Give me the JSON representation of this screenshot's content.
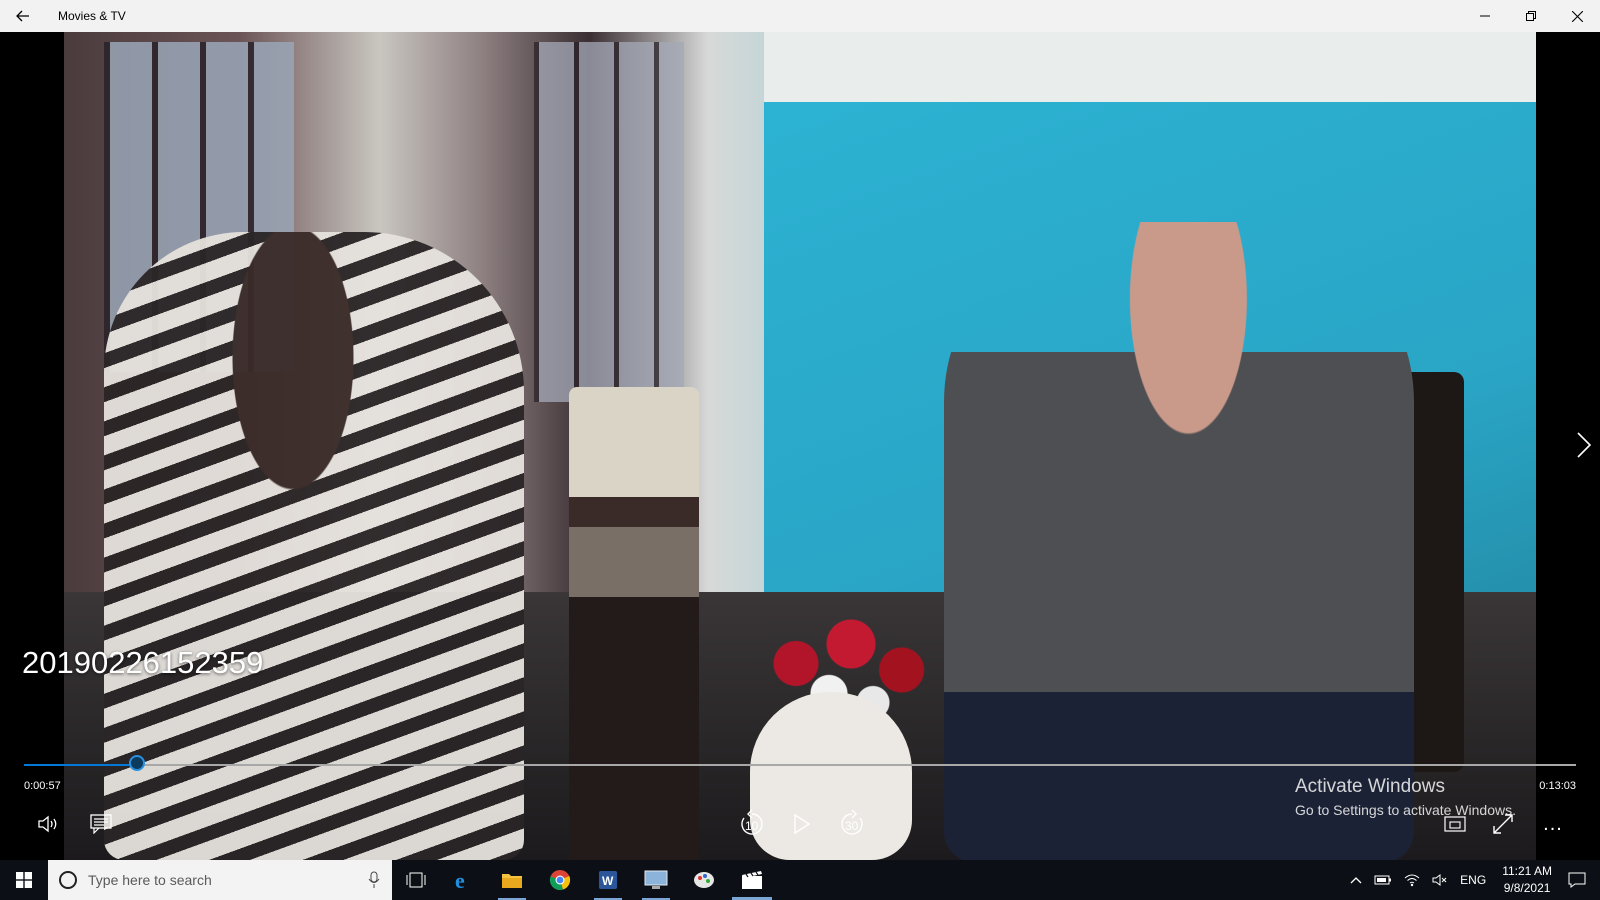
{
  "window": {
    "title": "Movies & TV",
    "back_icon": "back-arrow-icon",
    "minimize_icon": "minimize-icon",
    "restore_icon": "restore-icon",
    "close_icon": "close-icon"
  },
  "player": {
    "video_title": "20190226152359",
    "time_current": "0:00:57",
    "time_total": "0:13:03",
    "progress": 0.073,
    "controls": {
      "volume": "volume-icon",
      "subtitles": "subtitles-icon",
      "skip_back": "10",
      "play": "play-icon",
      "skip_forward": "30",
      "mini_view": "mini-view-icon",
      "fullscreen": "fullscreen-icon",
      "more": "..."
    }
  },
  "watermark": {
    "line1": "Activate Windows",
    "line2": "Go to Settings to activate Windows."
  },
  "taskbar": {
    "search_placeholder": "Type here to search",
    "apps": [
      "task-view-icon",
      "edge-icon",
      "file-explorer-icon",
      "chrome-icon",
      "word-icon",
      "remote-desktop-icon",
      "paint-icon",
      "movies-tv-icon"
    ],
    "language": "ENG",
    "time": "11:21 AM",
    "date": "9/8/2021"
  },
  "colors": {
    "accent": "#0078d7",
    "taskbar": "#0c1016",
    "titlebar": "#f2f2f2"
  }
}
